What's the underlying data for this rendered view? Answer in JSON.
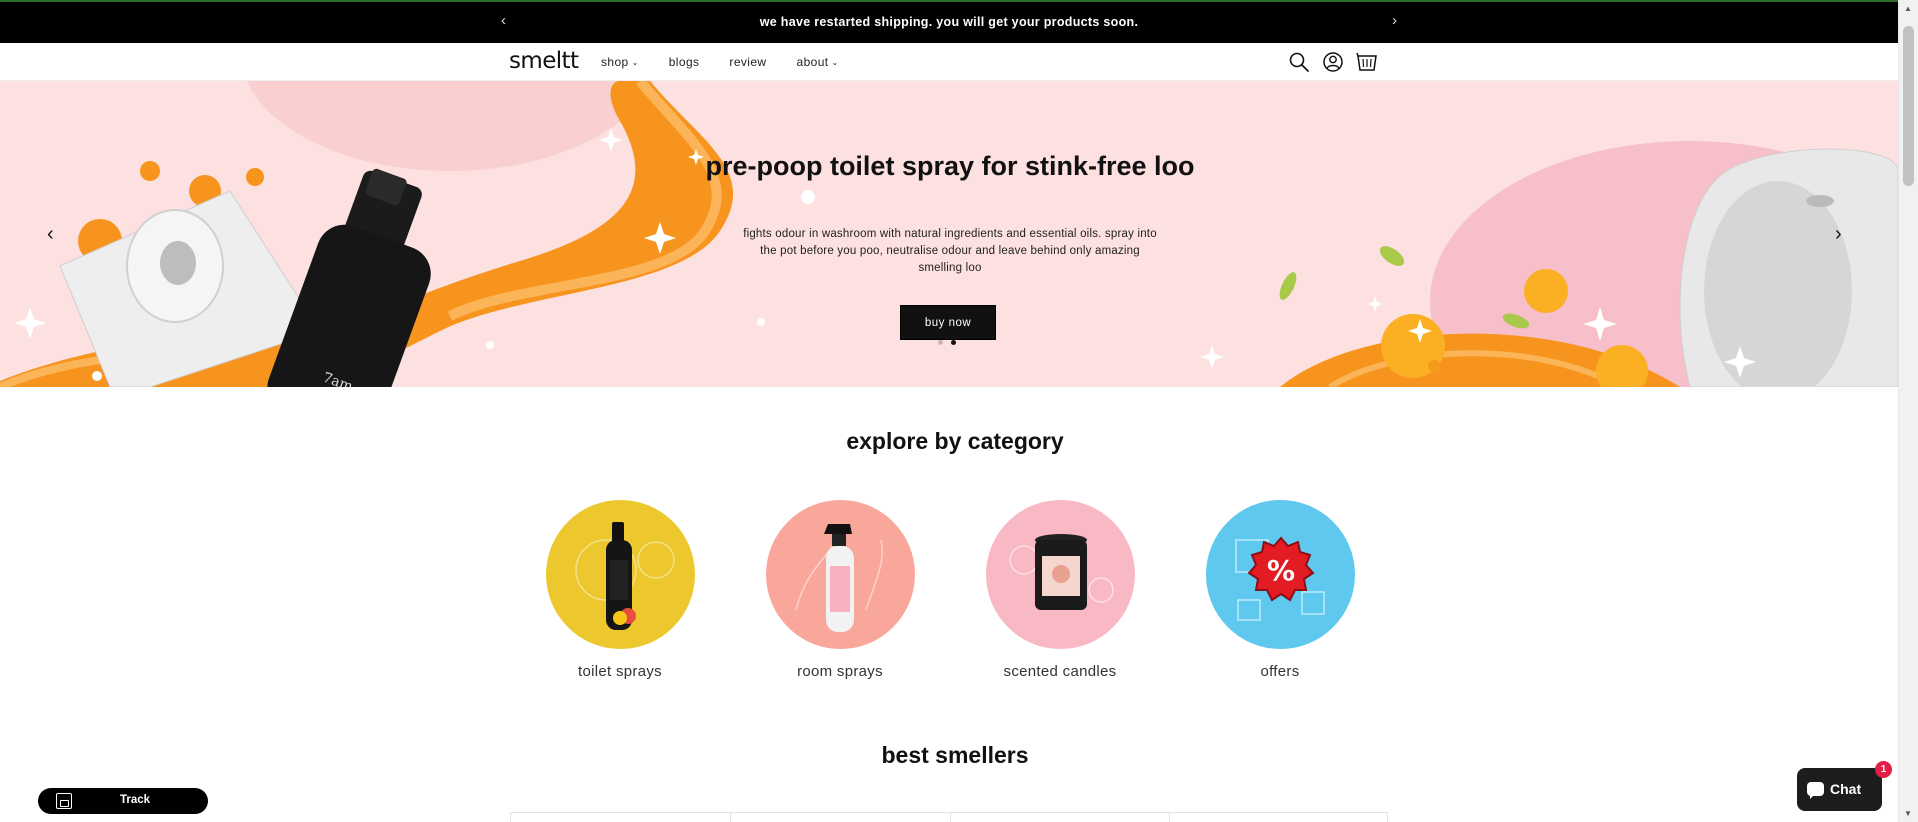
{
  "announcement": {
    "text": "we have restarted shipping. you will get your products soon.",
    "prev_arrow": "‹",
    "next_arrow": "›"
  },
  "header": {
    "logo": "smeltt",
    "nav": [
      {
        "label": "shop",
        "has_dropdown": true
      },
      {
        "label": "blogs",
        "has_dropdown": false
      },
      {
        "label": "review",
        "has_dropdown": false
      },
      {
        "label": "about",
        "has_dropdown": true
      }
    ],
    "icons": [
      "search-icon",
      "account-icon",
      "cart-icon"
    ]
  },
  "hero": {
    "title": "pre-poop toilet spray for stink-free loo",
    "subtitle": "fights odour in washroom with natural ingredients and essential oils. spray into the pot before you poo, neutralise odour and leave behind only amazing smelling loo",
    "button_label": "buy now",
    "slides_total": 2,
    "active_slide": 2,
    "bottle_label": "7am",
    "colors": {
      "background": "#fde0e0",
      "accent": "#f7941d"
    }
  },
  "categories": {
    "title": "explore by category",
    "items": [
      {
        "label": "toilet sprays",
        "color": "#ecc82e"
      },
      {
        "label": "room sprays",
        "color": "#f9a79a"
      },
      {
        "label": "scented candles",
        "color": "#f9b9c4"
      },
      {
        "label": "offers",
        "color": "#5fc8ee"
      }
    ]
  },
  "best_smellers": {
    "title": "best smellers"
  },
  "track": {
    "label": "Track"
  },
  "chat": {
    "label": "Chat",
    "badge": "1"
  }
}
